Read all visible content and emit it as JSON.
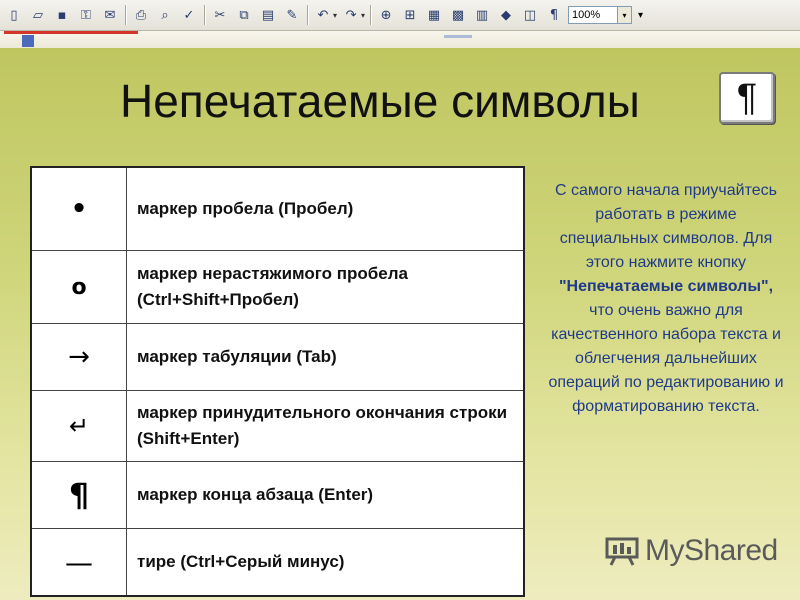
{
  "toolbar": {
    "zoom": "100%",
    "icons": [
      "new-doc-icon",
      "open-icon",
      "save-icon",
      "permission-icon",
      "email-icon",
      "print-icon",
      "print-preview-icon",
      "spelling-icon",
      "cut-icon",
      "copy-icon",
      "paste-icon",
      "format-painter-icon",
      "undo-icon",
      "redo-icon",
      "hyperlink-icon",
      "tables-borders-icon",
      "insert-table-icon",
      "insert-excel-icon",
      "columns-icon",
      "drawing-icon",
      "document-map-icon",
      "show-hide-icon"
    ]
  },
  "slide": {
    "title": "Непечатаемые символы",
    "button_symbol": "¶",
    "rows": [
      {
        "symbol": "•",
        "desc": "маркер пробела (Пробел)"
      },
      {
        "symbol": "o",
        "desc": "маркер нерастяжимого пробела (Ctrl+Shift+Пробел)"
      },
      {
        "symbol": "→",
        "desc": "маркер табуляции (Tab)"
      },
      {
        "symbol": "↵",
        "desc": "маркер принудительного окончания строки (Shift+Enter)"
      },
      {
        "symbol": "¶",
        "desc": "маркер конца абзаца (Enter)"
      },
      {
        "symbol": "—",
        "desc": "тире (Ctrl+Серый минус)"
      }
    ],
    "note": {
      "before": "С самого начала приучайтесь работать в режиме специальных символов. Для этого нажмите кнопку ",
      "bold": "\"Непечатаемые символы\",",
      "after": " что очень важно для качественного набора текста и облегчения дальнейших операций по редактированию и форматированию текста."
    },
    "logo": "MyShared"
  },
  "colors": {
    "note_text": "#1f3a8a",
    "background_top": "#bfc660",
    "background_bottom": "#eeecbf"
  }
}
